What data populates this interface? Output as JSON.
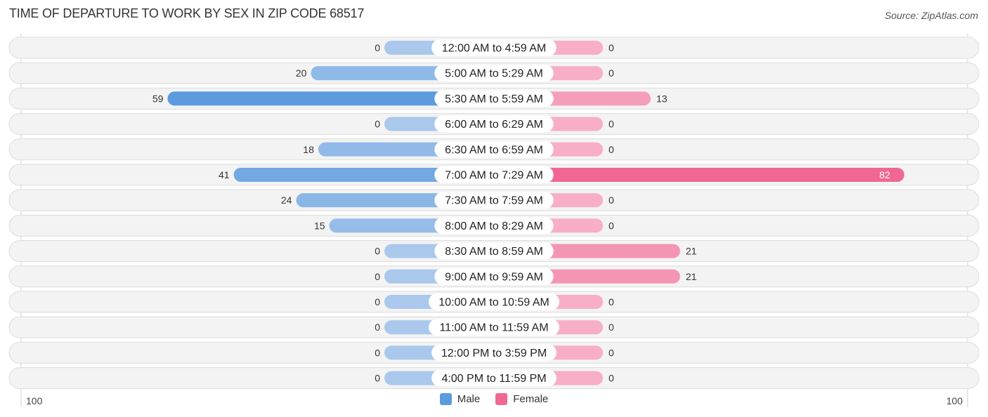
{
  "chart_data": {
    "type": "bar",
    "orientation": "horizontal-diverging",
    "title": "TIME OF DEPARTURE TO WORK BY SEX IN ZIP CODE 68517",
    "source": "Source: ZipAtlas.com",
    "categories": [
      "12:00 AM to 4:59 AM",
      "5:00 AM to 5:29 AM",
      "5:30 AM to 5:59 AM",
      "6:00 AM to 6:29 AM",
      "6:30 AM to 6:59 AM",
      "7:00 AM to 7:29 AM",
      "7:30 AM to 7:59 AM",
      "8:00 AM to 8:29 AM",
      "8:30 AM to 8:59 AM",
      "9:00 AM to 9:59 AM",
      "10:00 AM to 10:59 AM",
      "11:00 AM to 11:59 AM",
      "12:00 PM to 3:59 PM",
      "4:00 PM to 11:59 PM"
    ],
    "series": [
      {
        "name": "Male",
        "color": "#5b9bde",
        "light_color": "#aac8ec",
        "values": [
          0,
          20,
          59,
          0,
          18,
          41,
          24,
          15,
          0,
          0,
          0,
          0,
          0,
          0
        ]
      },
      {
        "name": "Female",
        "color": "#f06792",
        "light_color": "#f7aec6",
        "values": [
          0,
          0,
          13,
          0,
          0,
          82,
          0,
          0,
          21,
          21,
          0,
          0,
          0,
          0
        ]
      }
    ],
    "axis": {
      "left_label": "100",
      "right_label": "100",
      "max": 100
    },
    "legend": {
      "position": "bottom-center",
      "items": [
        "Male",
        "Female"
      ]
    }
  }
}
